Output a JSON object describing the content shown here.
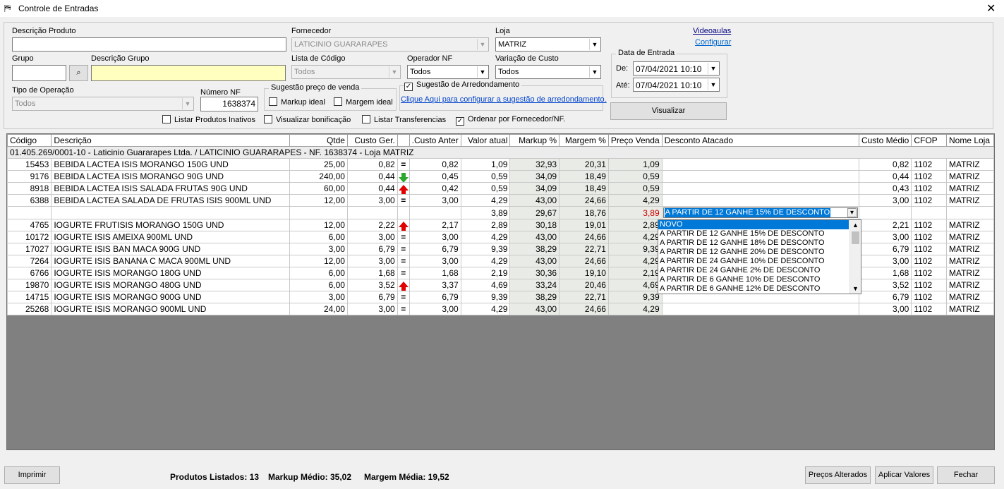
{
  "window": {
    "title": "Controle de Entradas"
  },
  "form": {
    "descricao_produto": {
      "label": "Descrição Produto",
      "value": ""
    },
    "fornecedor": {
      "label": "Fornecedor",
      "value": "LATICINIO GUARARAPES"
    },
    "loja": {
      "label": "Loja",
      "value": "MATRIZ"
    },
    "grupo": {
      "label": "Grupo",
      "value": ""
    },
    "descricao_grupo": {
      "label": "Descrição Grupo",
      "value": ""
    },
    "lista_codigo": {
      "label": "Lista de Código",
      "value": "Todos"
    },
    "operador_nf": {
      "label": "Operador NF",
      "value": "Todos"
    },
    "variacao_custo": {
      "label": "Variação de Custo",
      "value": "Todos"
    },
    "tipo_operacao": {
      "label": "Tipo de Operação",
      "value": "Todos"
    },
    "numero_nf": {
      "label": "Número NF",
      "value": "1638374"
    },
    "sugestao_preco": {
      "title": "Sugestão preço de venda",
      "markup_ideal": "Markup ideal",
      "margem_ideal": "Margem ideal"
    },
    "arredondamento": {
      "title": "Sugestão de Arredondamento",
      "link": "Clique Aqui para configurar a sugestão de arredondamento."
    },
    "data_entrada": {
      "title": "Data de Entrada",
      "de_label": "De:",
      "de_value": "07/04/2021 10:10",
      "ate_label": "Até:",
      "ate_value": "07/04/2021 10:10"
    },
    "videoaulas": "Videoaulas",
    "configurar": "Configurar",
    "visualizar": "Visualizar",
    "checkboxes": {
      "inativos": "Listar Produtos Inativos",
      "bonificacao": "Visualizar bonificação",
      "transferencias": "Listar Transferencias",
      "ordenar": "Ordenar por Fornecedor/NF."
    }
  },
  "grid": {
    "columns": [
      "Código",
      "Descrição",
      "Qtde",
      "Custo Ger.",
      "",
      "Custo Anter.",
      "Valor atual",
      "Markup %",
      "Margem %",
      "Preço Venda",
      "Desconto Atacado",
      "Custo Médio",
      "CFOP",
      "Nome Loja"
    ],
    "group_header": "01.405.269/0001-10  -  Laticinio Guararapes Ltda. / LATICINIO GUARARAPES  -  NF. 1638374  -  Loja MATRIZ",
    "rows": [
      {
        "codigo": "15453",
        "descricao": "BEBIDA LACTEA ISIS MORANGO 150G UND",
        "qtde": "25,00",
        "custo_ger": "0,82",
        "ind": "eq",
        "custo_anter": "0,82",
        "valor_atual": "1,09",
        "markup": "32,93",
        "margem": "20,31",
        "preco": "1,09",
        "desconto": "",
        "custo_medio": "0,82",
        "cfop": "1102",
        "loja": "MATRIZ"
      },
      {
        "codigo": "9176",
        "descricao": "BEBIDA LACTEA ISIS MORANGO 90G UND",
        "qtde": "240,00",
        "custo_ger": "0,44",
        "ind": "down",
        "custo_anter": "0,45",
        "valor_atual": "0,59",
        "markup": "34,09",
        "margem": "18,49",
        "preco": "0,59",
        "desconto": "",
        "custo_medio": "0,44",
        "cfop": "1102",
        "loja": "MATRIZ"
      },
      {
        "codigo": "8918",
        "descricao": "BEBIDA LACTEA ISIS SALADA FRUTAS 90G UND",
        "qtde": "60,00",
        "custo_ger": "0,44",
        "ind": "up",
        "custo_anter": "0,42",
        "valor_atual": "0,59",
        "markup": "34,09",
        "margem": "18,49",
        "preco": "0,59",
        "desconto": "",
        "custo_medio": "0,43",
        "cfop": "1102",
        "loja": "MATRIZ"
      },
      {
        "codigo": "6388",
        "descricao": "BEBIDA LACTEA SALADA DE FRUTAS ISIS 900ML UND",
        "qtde": "12,00",
        "custo_ger": "3,00",
        "ind": "eq",
        "custo_anter": "3,00",
        "valor_atual": "4,29",
        "markup": "43,00",
        "margem": "24,66",
        "preco": "4,29",
        "desconto": "",
        "custo_medio": "3,00",
        "cfop": "1102",
        "loja": "MATRIZ"
      },
      {
        "codigo": "",
        "descricao": "",
        "qtde": "",
        "custo_ger": "",
        "ind": "",
        "custo_anter": "",
        "valor_atual": "3,89",
        "markup": "29,67",
        "margem": "18,76",
        "preco": "3,89",
        "desconto": "A PARTIR DE 12 GANHE 15% DE DESCONTO",
        "custo_medio": "",
        "cfop": "",
        "loja": "",
        "edit": true
      },
      {
        "codigo": "4765",
        "descricao": "IOGURTE FRUTISIS MORANGO 150G UND",
        "qtde": "12,00",
        "custo_ger": "2,22",
        "ind": "up",
        "custo_anter": "2,17",
        "valor_atual": "2,89",
        "markup": "30,18",
        "margem": "19,01",
        "preco": "2,89",
        "desconto": "",
        "custo_medio": "2,21",
        "cfop": "1102",
        "loja": "MATRIZ"
      },
      {
        "codigo": "10172",
        "descricao": "IOGURTE ISIS AMEIXA 900ML UND",
        "qtde": "6,00",
        "custo_ger": "3,00",
        "ind": "eq",
        "custo_anter": "3,00",
        "valor_atual": "4,29",
        "markup": "43,00",
        "margem": "24,66",
        "preco": "4,29",
        "desconto": "",
        "custo_medio": "3,00",
        "cfop": "1102",
        "loja": "MATRIZ"
      },
      {
        "codigo": "17027",
        "descricao": "IOGURTE ISIS BAN MACA 900G UND",
        "qtde": "3,00",
        "custo_ger": "6,79",
        "ind": "eq",
        "custo_anter": "6,79",
        "valor_atual": "9,39",
        "markup": "38,29",
        "margem": "22,71",
        "preco": "9,39",
        "desconto": "",
        "custo_medio": "6,79",
        "cfop": "1102",
        "loja": "MATRIZ"
      },
      {
        "codigo": "7264",
        "descricao": "IOGURTE ISIS BANANA C  MACA 900ML UND",
        "qtde": "12,00",
        "custo_ger": "3,00",
        "ind": "eq",
        "custo_anter": "3,00",
        "valor_atual": "4,29",
        "markup": "43,00",
        "margem": "24,66",
        "preco": "4,29",
        "desconto": "",
        "custo_medio": "3,00",
        "cfop": "1102",
        "loja": "MATRIZ"
      },
      {
        "codigo": "6766",
        "descricao": "IOGURTE ISIS MORANGO 180G UND",
        "qtde": "6,00",
        "custo_ger": "1,68",
        "ind": "eq",
        "custo_anter": "1,68",
        "valor_atual": "2,19",
        "markup": "30,36",
        "margem": "19,10",
        "preco": "2,19",
        "desconto": "",
        "custo_medio": "1,68",
        "cfop": "1102",
        "loja": "MATRIZ"
      },
      {
        "codigo": "19870",
        "descricao": "IOGURTE ISIS MORANGO 480G UND",
        "qtde": "6,00",
        "custo_ger": "3,52",
        "ind": "up",
        "custo_anter": "3,37",
        "valor_atual": "4,69",
        "markup": "33,24",
        "margem": "20,46",
        "preco": "4,69",
        "desconto": "",
        "custo_medio": "3,52",
        "cfop": "1102",
        "loja": "MATRIZ"
      },
      {
        "codigo": "14715",
        "descricao": "IOGURTE ISIS MORANGO 900G UND",
        "qtde": "3,00",
        "custo_ger": "6,79",
        "ind": "eq",
        "custo_anter": "6,79",
        "valor_atual": "9,39",
        "markup": "38,29",
        "margem": "22,71",
        "preco": "9,39",
        "desconto": "",
        "custo_medio": "6,79",
        "cfop": "1102",
        "loja": "MATRIZ"
      },
      {
        "codigo": "25268",
        "descricao": "IOGURTE ISIS MORANGO 900ML UND",
        "qtde": "24,00",
        "custo_ger": "3,00",
        "ind": "eq",
        "custo_anter": "3,00",
        "valor_atual": "4,29",
        "markup": "43,00",
        "margem": "24,66",
        "preco": "4,29",
        "desconto": "",
        "custo_medio": "3,00",
        "cfop": "1102",
        "loja": "MATRIZ"
      }
    ],
    "dropdown_options": [
      "NOVO",
      "A PARTIR DE 12 GANHE 15% DE DESCONTO",
      "A PARTIR DE 12 GANHE 18% DE DESCONTO",
      "A PARTIR DE 12 GANHE 20% DE DESCONTO",
      "A PARTIR DE 24 GANHE 10% DE DESCONTO",
      "A PARTIR DE 24 GANHE 2% DE DESCONTO",
      "A PARTIR DE 6 GANHE 10% DE DESCONTO",
      "A PARTIR DE 6 GANHE 12% DE DESCONTO"
    ],
    "colors": {
      "edit_price": "#d00000",
      "up_arrow": "#e00000",
      "down_arrow": "#2ba82b",
      "selection": "#0078d7"
    }
  },
  "footer": {
    "imprimir": "Imprimir",
    "produtos_listados": "Produtos Listados: 13",
    "markup_medio": "Markup Médio: 35,02",
    "margem_media": "Margem Média: 19,52",
    "precos_alterados": "Preços Alterados",
    "aplicar_valores": "Aplicar Valores",
    "fechar": "Fechar"
  }
}
